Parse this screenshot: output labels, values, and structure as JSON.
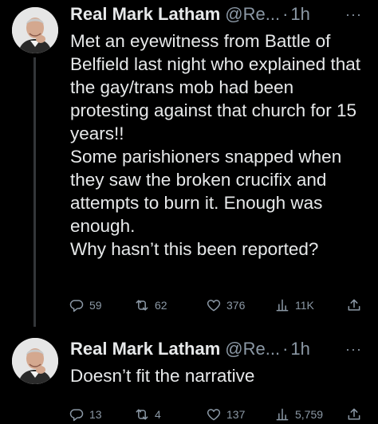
{
  "tweets": [
    {
      "display_name": "Real Mark Latham",
      "handle": "@Re...",
      "separator": "·",
      "time": "1h",
      "more": "···",
      "text": "Met an eyewitness from Battle of Belfield last night who explained that the gay/trans mob had been protesting against that church for 15 years!!\nSome parishioners snapped when they saw the broken crucifix and attempts to burn it. Enough was enough.\nWhy hasn’t this been reported?",
      "replies": "59",
      "retweets": "62",
      "likes": "376",
      "views": "11K"
    },
    {
      "display_name": "Real Mark Latham",
      "handle": "@Re...",
      "separator": "·",
      "time": "1h",
      "more": "···",
      "text": "Doesn’t fit the narrative",
      "replies": "13",
      "retweets": "4",
      "likes": "137",
      "views": "5,759"
    }
  ],
  "icons": {
    "reply": "reply-icon",
    "retweet": "retweet-icon",
    "like": "heart-icon",
    "views": "views-icon",
    "share": "share-icon",
    "more": "more-icon"
  },
  "colors": {
    "background": "#000000",
    "text": "#e7e9ea",
    "secondary": "#8b98a5",
    "thread_line": "#333639"
  }
}
